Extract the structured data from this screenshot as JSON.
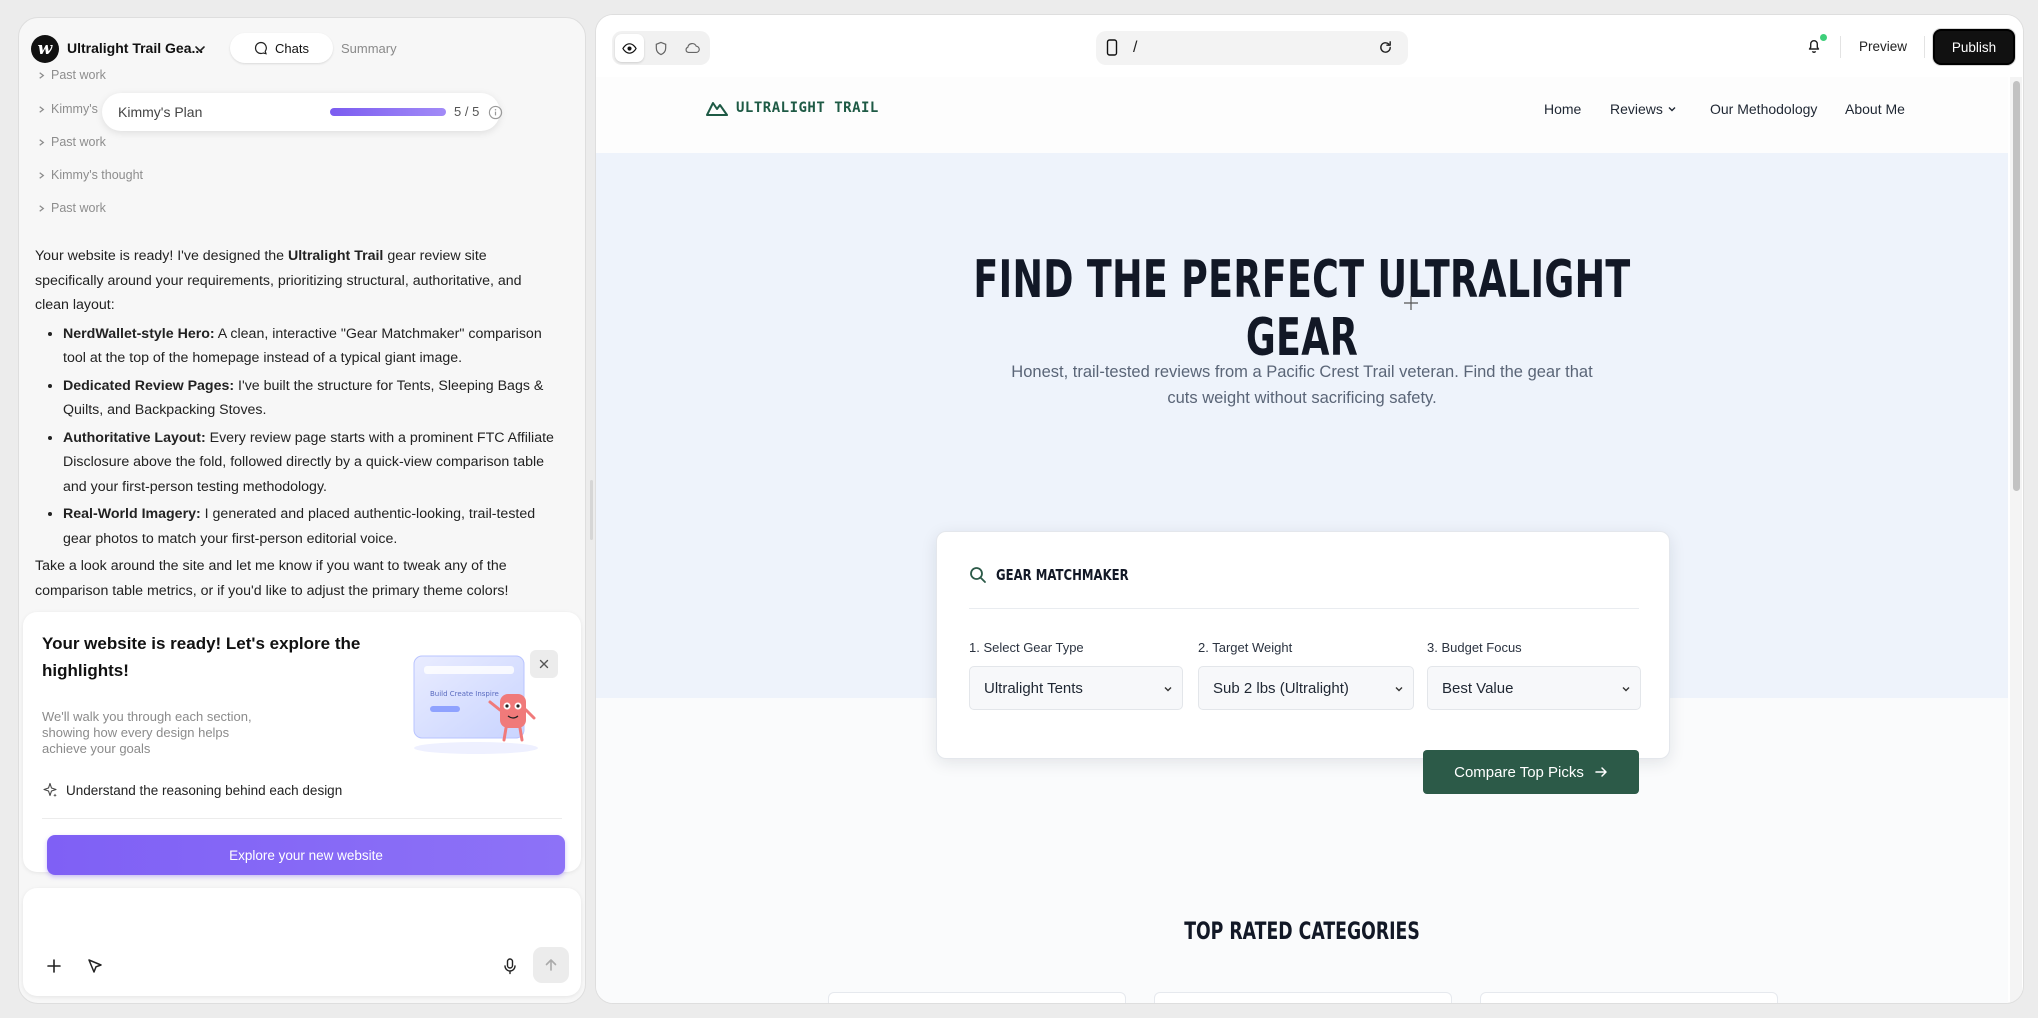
{
  "app": {
    "project_name": "Ultralight Trail Gea...",
    "logo_letter": "w",
    "tabs": {
      "chats": "Chats",
      "summary": "Summary"
    }
  },
  "thread": {
    "items": [
      {
        "label": "Past work"
      },
      {
        "label": "Kimmy's"
      },
      {
        "label": "Past work"
      },
      {
        "label": "Kimmy's thought"
      },
      {
        "label": "Past work"
      }
    ],
    "plan": {
      "title": "Kimmy's Plan",
      "progress_text": "5 / 5",
      "progress": 1.0
    }
  },
  "message": {
    "intro_before": "Your website is ready! I've designed the ",
    "intro_bold": "Ultralight Trail",
    "intro_after": " gear review site specifically around your requirements, prioritizing structural, authoritative, and clean layout:",
    "bullets": [
      {
        "title": "NerdWallet-style Hero:",
        "text": " A clean, interactive \"Gear Matchmaker\" comparison tool at the top of the homepage instead of a typical giant image."
      },
      {
        "title": "Dedicated Review Pages:",
        "text": " I've built the structure for Tents, Sleeping Bags & Quilts, and Backpacking Stoves."
      },
      {
        "title": "Authoritative Layout:",
        "text": " Every review page starts with a prominent FTC Affiliate Disclosure above the fold, followed directly by a quick-view comparison table and your first-person testing methodology."
      },
      {
        "title": "Real-World Imagery:",
        "text": " I generated and placed authentic-looking, trail-tested gear photos to match your first-person editorial voice."
      }
    ],
    "outro": "Take a look around the site and let me know if you want to tweak any of the comparison table metrics, or if you'd like to adjust the primary theme colors!"
  },
  "tour": {
    "title": "Your website is ready! Let's explore the highlights!",
    "description": "We'll walk you through each section, showing how every design helps achieve your goals",
    "feature": "Understand the reasoning behind each design",
    "button": "Explore your new website",
    "art_text": "Build Create Inspire"
  },
  "toolbar": {
    "url_path": "/",
    "preview": "Preview",
    "publish": "Publish"
  },
  "site": {
    "brand": "ULTRALIGHT TRAIL",
    "nav": [
      "Home",
      "Reviews",
      "Our Methodology",
      "About Me"
    ],
    "hero_title_line1": "FIND THE PERFECT ULTRALIGHT",
    "hero_title_line2": "GEAR",
    "hero_sub_line1": "Honest, trail-tested reviews from a Pacific Crest Trail veteran. Find the gear that",
    "hero_sub_line2": "cuts weight without sacrificing safety.",
    "matcher": {
      "title": "GEAR MATCHMAKER",
      "fields": [
        {
          "label": "1. Select Gear Type",
          "value": "Ultralight Tents"
        },
        {
          "label": "2. Target Weight",
          "value": "Sub 2 lbs (Ultralight)"
        },
        {
          "label": "3. Budget Focus",
          "value": "Best Value"
        }
      ],
      "cta": "Compare Top Picks"
    },
    "section_title": "TOP RATED CATEGORIES"
  },
  "colors": {
    "accent_purple": "#7f60f5",
    "brand_green": "#2c5a48",
    "hero_bg": "#eef3fb"
  }
}
